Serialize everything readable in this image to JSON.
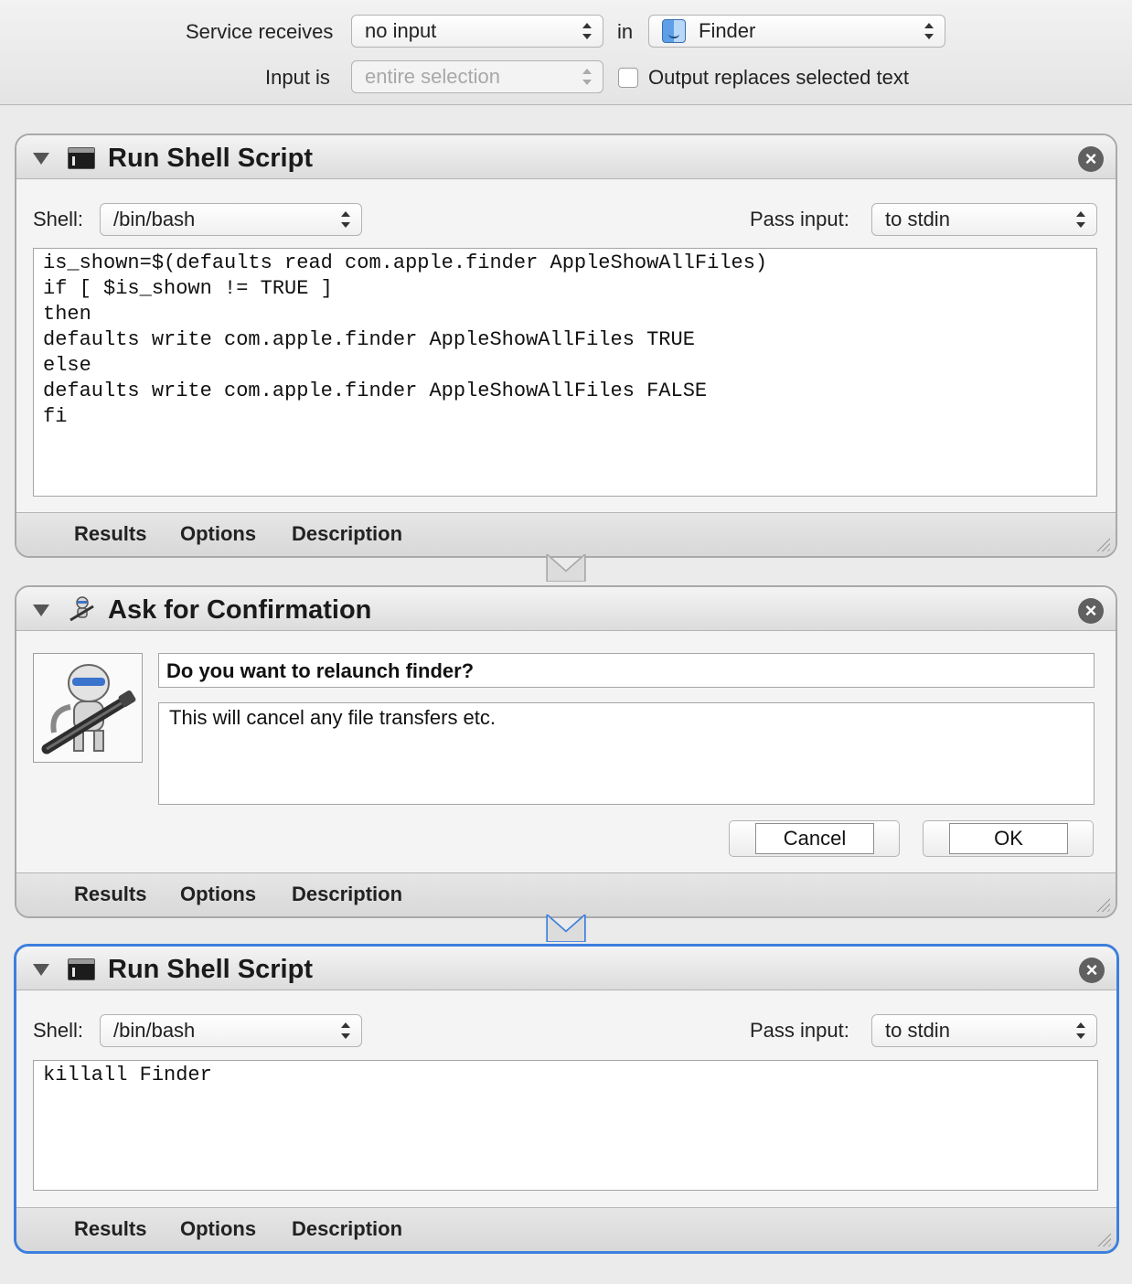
{
  "header": {
    "service_receives_label": "Service receives",
    "input_type": "no input",
    "in_label": "in",
    "application": "Finder",
    "application_icon": "finder-icon",
    "input_is_label": "Input is",
    "input_is_value": "entire selection",
    "output_replaces_label": "Output replaces selected text",
    "output_replaces_checked": false
  },
  "actions": [
    {
      "title": "Run Shell Script",
      "icon": "terminal-icon",
      "shell_label": "Shell:",
      "shell": "/bin/bash",
      "pass_input_label": "Pass input:",
      "pass_input": "to stdin",
      "script": "is_shown=$(defaults read com.apple.finder AppleShowAllFiles)\nif [ $is_shown != TRUE ]\nthen\ndefaults write com.apple.finder AppleShowAllFiles TRUE\nelse\ndefaults write com.apple.finder AppleShowAllFiles FALSE\nfi",
      "footer_tabs": [
        "Results",
        "Options",
        "Description"
      ]
    },
    {
      "title": "Ask for Confirmation",
      "icon": "automator-robot-icon",
      "message": "Do you want to relaunch finder?",
      "detail": "This will cancel any file transfers etc.",
      "cancel_label": "Cancel",
      "ok_label": "OK",
      "footer_tabs": [
        "Results",
        "Options",
        "Description"
      ]
    },
    {
      "title": "Run Shell Script",
      "icon": "terminal-icon",
      "shell_label": "Shell:",
      "shell": "/bin/bash",
      "pass_input_label": "Pass input:",
      "pass_input": "to stdin",
      "script": "killall Finder",
      "footer_tabs": [
        "Results",
        "Options",
        "Description"
      ],
      "selected": true
    }
  ],
  "colors": {
    "selection": "#3d7fdc",
    "background": "#ebebeb"
  }
}
